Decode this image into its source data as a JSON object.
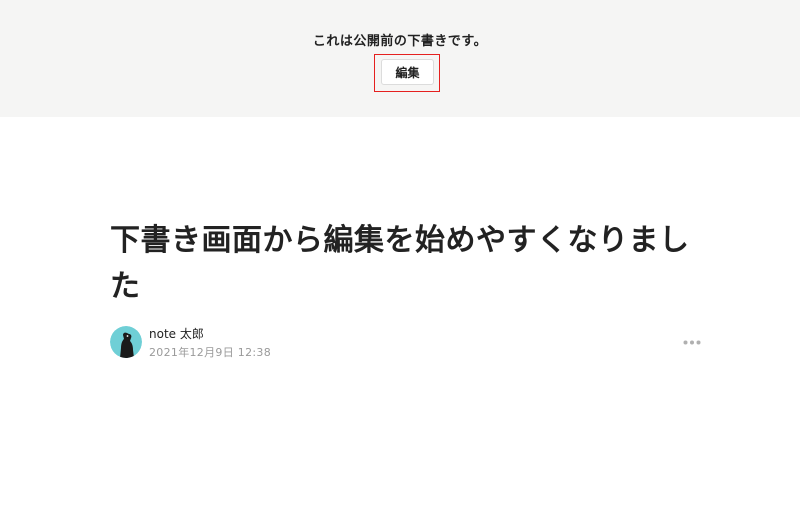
{
  "draft_banner": {
    "message": "これは公開前の下書きです。",
    "edit_label": "編集"
  },
  "article": {
    "title": "下書き画面から編集を始めやすくなりました"
  },
  "author": {
    "name": "note 太郎",
    "date": "2021年12月9日 12:38",
    "avatar_icon": "dog-silhouette-avatar"
  },
  "actions": {
    "more_icon": "ellipsis-horizontal-icon"
  },
  "colors": {
    "banner_bg": "#f5f5f4",
    "highlight_border": "#e5201f",
    "avatar_bg": "#6fcfd6",
    "meta_text": "#9a9a9a",
    "title_text": "#222222"
  }
}
